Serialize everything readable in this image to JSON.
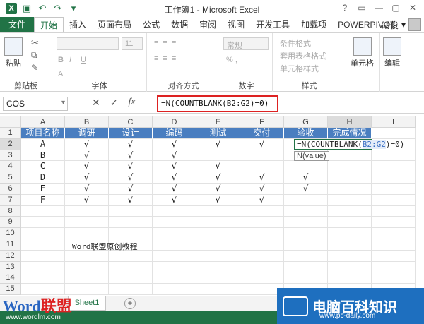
{
  "window": {
    "title": "工作簿1 - Microsoft Excel",
    "controls": [
      "?",
      "▭",
      "—",
      "▢",
      "✕"
    ]
  },
  "tabs": [
    "文件",
    "开始",
    "插入",
    "页面布局",
    "公式",
    "数据",
    "审阅",
    "视图",
    "开发工具",
    "加载项",
    "POWERPIVOT"
  ],
  "active_tab": "开始",
  "user": "胡俊",
  "ribbon": {
    "clipboard": {
      "paste": "粘贴",
      "label": "剪贴板"
    },
    "font": {
      "size": "11",
      "label": "字体"
    },
    "alignment": {
      "label": "对齐方式"
    },
    "number": {
      "format": "常规",
      "label": "数字"
    },
    "styles": {
      "items": [
        "条件格式",
        "套用表格格式",
        "单元格样式"
      ],
      "label": "样式"
    },
    "cells": {
      "label": "单元格"
    },
    "editing": {
      "label": "编辑"
    }
  },
  "formula_bar": {
    "name_box": "COS",
    "cancel": "✕",
    "enter": "✓",
    "fx": "fx",
    "formula": "=N(COUNTBLANK(B2:G2)=0)"
  },
  "columns": [
    "A",
    "B",
    "C",
    "D",
    "E",
    "F",
    "G",
    "H",
    "I"
  ],
  "rows": [
    "1",
    "2",
    "3",
    "4",
    "5",
    "6",
    "7",
    "8",
    "9",
    "10",
    "11",
    "12",
    "13",
    "14",
    "15"
  ],
  "headers": [
    "项目名称",
    "调研",
    "设计",
    "编码",
    "测试",
    "交付",
    "验收",
    "完成情况"
  ],
  "data": [
    {
      "name": "A",
      "marks": [
        "√",
        "√",
        "√",
        "√",
        "√",
        ""
      ]
    },
    {
      "name": "B",
      "marks": [
        "√",
        "√",
        "√",
        "",
        "",
        ""
      ]
    },
    {
      "name": "C",
      "marks": [
        "√",
        "√",
        "√",
        "√",
        "",
        ""
      ]
    },
    {
      "name": "D",
      "marks": [
        "√",
        "√",
        "√",
        "√",
        "√",
        "√"
      ]
    },
    {
      "name": "E",
      "marks": [
        "√",
        "√",
        "√",
        "√",
        "√",
        "√"
      ]
    },
    {
      "name": "F",
      "marks": [
        "√",
        "√",
        "√",
        "√",
        "√",
        ""
      ]
    }
  ],
  "editing": {
    "prefix": "=N(COUNTBLANK(",
    "ref": "B2:G2",
    "suffix": ")=0)",
    "tooltip": "N(value)"
  },
  "note": "Word联盟原创教程",
  "sheet": {
    "tab": "Sheet1",
    "add": "+"
  },
  "watermark_left": {
    "word": "Word",
    "cn": "联盟",
    "url": "www.wordlm.com"
  },
  "watermark_right": {
    "text": "电脑百科知识",
    "url": "www.pc-daily.com"
  },
  "colors": {
    "excel_green": "#217346",
    "header_blue": "#4a7ec0",
    "highlight_red": "#dd2222"
  }
}
